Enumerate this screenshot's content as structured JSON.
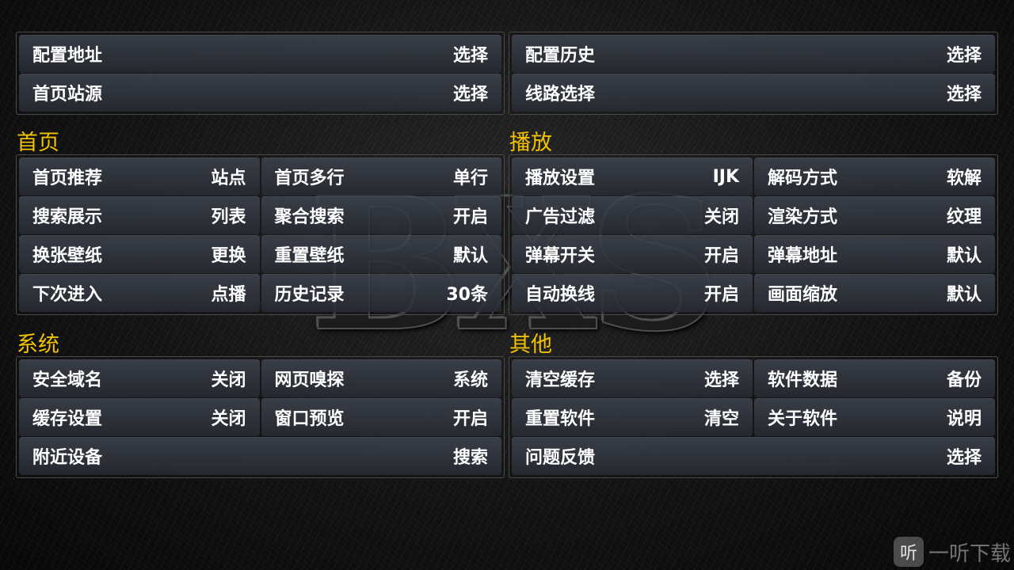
{
  "logo_text": "BXS",
  "top_left": [
    [
      {
        "label": "配置地址",
        "value": "选择"
      }
    ],
    [
      {
        "label": "首页站源",
        "value": "选择"
      }
    ]
  ],
  "top_right": [
    [
      {
        "label": "配置历史",
        "value": "选择"
      }
    ],
    [
      {
        "label": "线路选择",
        "value": "选择"
      }
    ]
  ],
  "sections": {
    "home": {
      "title": "首页",
      "rows": [
        [
          {
            "label": "首页推荐",
            "value": "站点"
          },
          {
            "label": "首页多行",
            "value": "单行"
          }
        ],
        [
          {
            "label": "搜索展示",
            "value": "列表"
          },
          {
            "label": "聚合搜索",
            "value": "开启"
          }
        ],
        [
          {
            "label": "换张壁纸",
            "value": "更换"
          },
          {
            "label": "重置壁纸",
            "value": "默认"
          }
        ],
        [
          {
            "label": "下次进入",
            "value": "点播"
          },
          {
            "label": "历史记录",
            "value": "30条"
          }
        ]
      ]
    },
    "play": {
      "title": "播放",
      "rows": [
        [
          {
            "label": "播放设置",
            "value": "IJK"
          },
          {
            "label": "解码方式",
            "value": "软解"
          }
        ],
        [
          {
            "label": "广告过滤",
            "value": "关闭"
          },
          {
            "label": "渲染方式",
            "value": "纹理"
          }
        ],
        [
          {
            "label": "弹幕开关",
            "value": "开启"
          },
          {
            "label": "弹幕地址",
            "value": "默认"
          }
        ],
        [
          {
            "label": "自动换线",
            "value": "开启"
          },
          {
            "label": "画面缩放",
            "value": "默认"
          }
        ]
      ]
    },
    "system": {
      "title": "系统",
      "rows": [
        [
          {
            "label": "安全域名",
            "value": "关闭"
          },
          {
            "label": "网页嗅探",
            "value": "系统"
          }
        ],
        [
          {
            "label": "缓存设置",
            "value": "关闭"
          },
          {
            "label": "窗口预览",
            "value": "开启"
          }
        ],
        [
          {
            "label": "附近设备",
            "value": "搜索"
          }
        ]
      ]
    },
    "other": {
      "title": "其他",
      "rows": [
        [
          {
            "label": "清空缓存",
            "value": "选择"
          },
          {
            "label": "软件数据",
            "value": "备份"
          }
        ],
        [
          {
            "label": "重置软件",
            "value": "清空"
          },
          {
            "label": "关于软件",
            "value": "说明"
          }
        ],
        [
          {
            "label": "问题反馈",
            "value": "选择"
          }
        ]
      ]
    }
  },
  "watermark": {
    "icon": "听",
    "text": "一听下载"
  },
  "colors": {
    "section_title": "#f2c200",
    "cell_bg": "#353a44",
    "panel_border": "#4a4a4a"
  }
}
